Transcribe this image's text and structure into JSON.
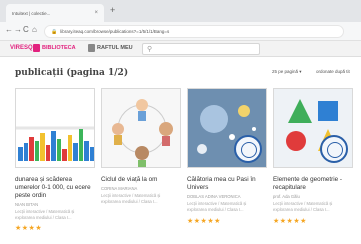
{
  "browser": {
    "tab_title": "Intuitext | colectie...",
    "tab_close": "×",
    "new_tab": "+",
    "back": "←",
    "forward": "→",
    "reload": "C",
    "home": "⌂",
    "url": "library.iteaq.com/browse/publications?=1/5/1/1/Bang=s"
  },
  "site": {
    "logo": "VIRESQ",
    "nav": [
      {
        "label": "BIBLIOTECA",
        "color": "#e2217e"
      },
      {
        "label": "RAFTUL MEU",
        "color": "#555555"
      }
    ],
    "search_icon": "search-icon"
  },
  "listing": {
    "title": "publicații (pagina 1/2)",
    "per_page": "25 pe pagină ▾",
    "sort": "ordonate după tit"
  },
  "cards": [
    {
      "title": "dunarea și scăderea umerelor 0-1 000, cu ecere peste ordin",
      "author": "NIAN BITAN",
      "meta": "Lecții interactive / Matematică și explorarea mediului / Clasa I...",
      "stars": "★★★★"
    },
    {
      "title": "Ciclul de viață la om",
      "author": "CORINA MARIANA",
      "meta": "Lecții interactive / Matematică și explorarea mediului / Clasa I...",
      "stars": ""
    },
    {
      "title": "Călătoria mea cu Pasi în Univers",
      "author": "DOBLAS ADINA VERONICA",
      "meta": "Lecții interactive / Matematică și explorarea mediului / Clasa I...",
      "stars": "★★★★★"
    },
    {
      "title": "Elemente de geometrie - recapitulare",
      "author": "prof. Ada Gălu",
      "meta": "Lecții interactive / Matematică și explorarea mediului / Clasa I...",
      "stars": "★★★★★"
    }
  ],
  "colors": {
    "accent": "#e2217e",
    "stars": "#f5a623",
    "badge": "#2a5fa8"
  }
}
